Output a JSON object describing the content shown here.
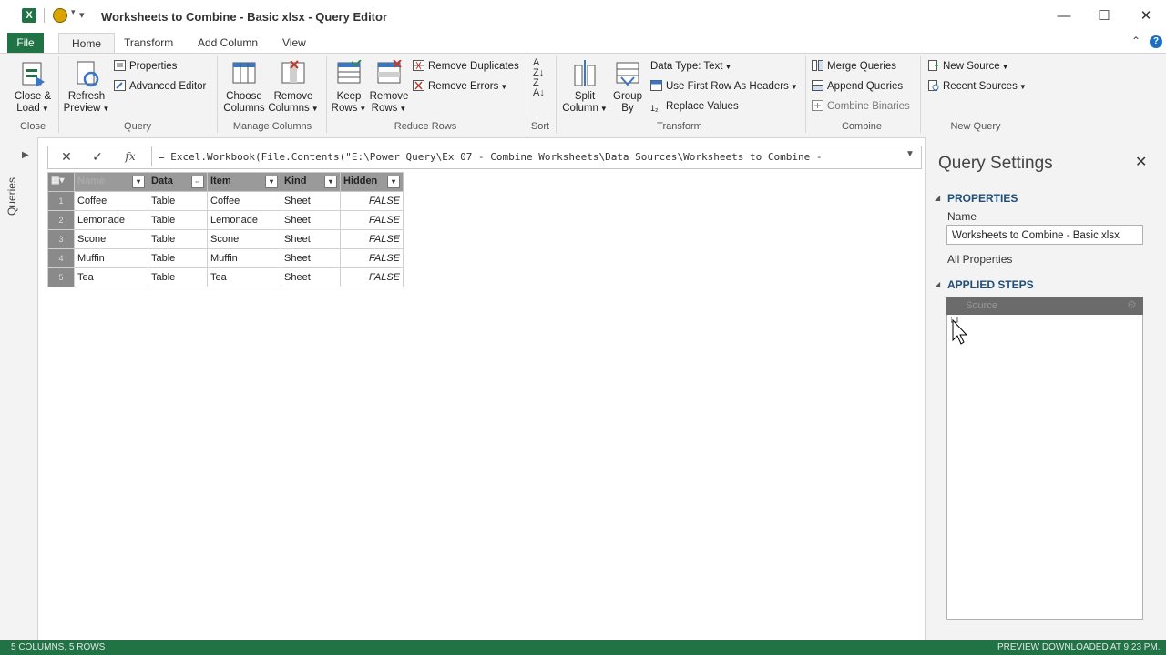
{
  "window": {
    "title": "Worksheets to Combine - Basic xlsx - Query Editor",
    "app_icon": "X",
    "controls": {
      "minimize": "—",
      "maximize": "☐",
      "close": "✕"
    }
  },
  "ribbon_tabs": [
    "File",
    "Home",
    "Transform",
    "Add Column",
    "View"
  ],
  "ribbon": {
    "close_group": {
      "label": "Close",
      "close_load": "Close &",
      "close_load2": "Load"
    },
    "query_group": {
      "label": "Query",
      "refresh": "Refresh",
      "refresh2": "Preview",
      "properties": "Properties",
      "advanced_editor": "Advanced Editor"
    },
    "manage_columns_group": {
      "label": "Manage Columns",
      "choose": "Choose",
      "choose2": "Columns",
      "remove": "Remove",
      "remove2": "Columns"
    },
    "reduce_rows_group": {
      "label": "Reduce Rows",
      "keep": "Keep",
      "keep2": "Rows",
      "remove": "Remove",
      "remove2": "Rows",
      "remove_duplicates": "Remove Duplicates",
      "remove_errors": "Remove Errors"
    },
    "sort_group": {
      "label": "Sort"
    },
    "transform_group": {
      "label": "Transform",
      "split": "Split",
      "split2": "Column",
      "group": "Group",
      "group2": "By",
      "data_type": "Data Type: Text",
      "first_row": "Use First Row As Headers",
      "replace": "Replace Values"
    },
    "combine_group": {
      "label": "Combine",
      "merge": "Merge Queries",
      "append": "Append Queries",
      "binaries": "Combine Binaries"
    },
    "new_query_group": {
      "label": "New Query",
      "new_source": "New Source",
      "recent_sources": "Recent Sources"
    }
  },
  "queries_pane": {
    "label": "Queries"
  },
  "formula_bar": {
    "cancel": "✕",
    "confirm": "✓",
    "fx": "fx",
    "formula": "= Excel.Workbook(File.Contents(\"E:\\Power Query\\Ex 07 - Combine Worksheets\\Data Sources\\Worksheets to Combine -"
  },
  "table": {
    "columns": [
      "Name",
      "Data",
      "Item",
      "Kind",
      "Hidden"
    ],
    "rows": [
      {
        "num": "1",
        "name": "Coffee",
        "data": "Table",
        "item": "Coffee",
        "kind": "Sheet",
        "hidden": "FALSE"
      },
      {
        "num": "2",
        "name": "Lemonade",
        "data": "Table",
        "item": "Lemonade",
        "kind": "Sheet",
        "hidden": "FALSE"
      },
      {
        "num": "3",
        "name": "Scone",
        "data": "Table",
        "item": "Scone",
        "kind": "Sheet",
        "hidden": "FALSE"
      },
      {
        "num": "4",
        "name": "Muffin",
        "data": "Table",
        "item": "Muffin",
        "kind": "Sheet",
        "hidden": "FALSE"
      },
      {
        "num": "5",
        "name": "Tea",
        "data": "Table",
        "item": "Tea",
        "kind": "Sheet",
        "hidden": "FALSE"
      }
    ]
  },
  "query_settings": {
    "title": "Query Settings",
    "close": "✕",
    "properties_header": "PROPERTIES",
    "name_label": "Name",
    "name_value": "Worksheets to Combine - Basic xlsx",
    "all_properties": "All Properties",
    "applied_steps_header": "APPLIED STEPS",
    "steps": [
      "Source"
    ]
  },
  "status": {
    "left": "5 COLUMNS, 5 ROWS",
    "right": "PREVIEW DOWNLOADED AT 9:23 PM."
  },
  "colors": {
    "excel_green": "#217346",
    "ribbon_bg": "#f3f3f3",
    "header_blue": "#1f4e79"
  }
}
